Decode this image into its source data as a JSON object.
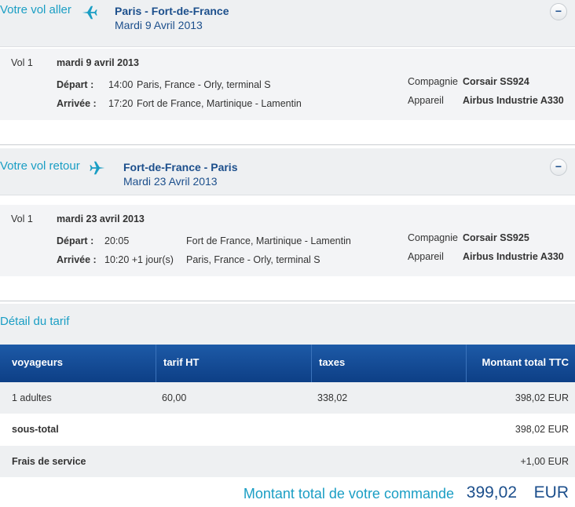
{
  "outbound": {
    "direction_label": "Votre vol aller",
    "route": "Paris - Fort-de-France",
    "date": "Mardi 9 Avril 2013",
    "collapse_label": "−",
    "flight_no_label": "Vol 1",
    "flight_date": "mardi 9 avril 2013",
    "depart_label": "Départ :",
    "depart_time": "14:00",
    "depart_place": "Paris, France - Orly, terminal S",
    "arrive_label": "Arrivée :",
    "arrive_time": "17:20",
    "arrive_place": "Fort de France, Martinique - Lamentin",
    "company_label": "Compagnie",
    "company_value": "Corsair SS924",
    "aircraft_label": "Appareil",
    "aircraft_value": "Airbus Industrie A330"
  },
  "return": {
    "direction_label": "Votre vol retour",
    "route": "Fort-de-France - Paris",
    "date": "Mardi 23 Avril 2013",
    "collapse_label": "−",
    "flight_no_label": "Vol 1",
    "flight_date": "mardi 23 avril 2013",
    "depart_label": "Départ :",
    "depart_time": "20:05",
    "depart_place": "Fort de France, Martinique - Lamentin",
    "arrive_label": "Arrivée :",
    "arrive_time": "10:20 +1 jour(s)",
    "arrive_place": "Paris, France - Orly, terminal S",
    "company_label": "Compagnie",
    "company_value": "Corsair SS925",
    "aircraft_label": "Appareil",
    "aircraft_value": "Airbus Industrie A330"
  },
  "tarif": {
    "title": "Détail du tarif",
    "columns": [
      "voyageurs",
      "tarif HT",
      "taxes",
      "Montant total TTC"
    ],
    "row": {
      "voyageurs": "1 adultes",
      "tarif_ht": "60,00",
      "taxes": "338,02",
      "total": "398,02 EUR"
    },
    "subtotal_label": "sous-total",
    "subtotal_value": "398,02 EUR",
    "fees_label": "Frais de service",
    "fees_value": "+1,00 EUR"
  },
  "order_total": {
    "label": "Montant total de votre commande",
    "amount": "399,02",
    "currency": "EUR"
  },
  "colors": {
    "accent": "#1a9ec4",
    "brand": "#1c4f8c",
    "table_header": "#15519a"
  },
  "icons": {
    "outbound": "airplane-icon",
    "return": "airplane-icon"
  }
}
